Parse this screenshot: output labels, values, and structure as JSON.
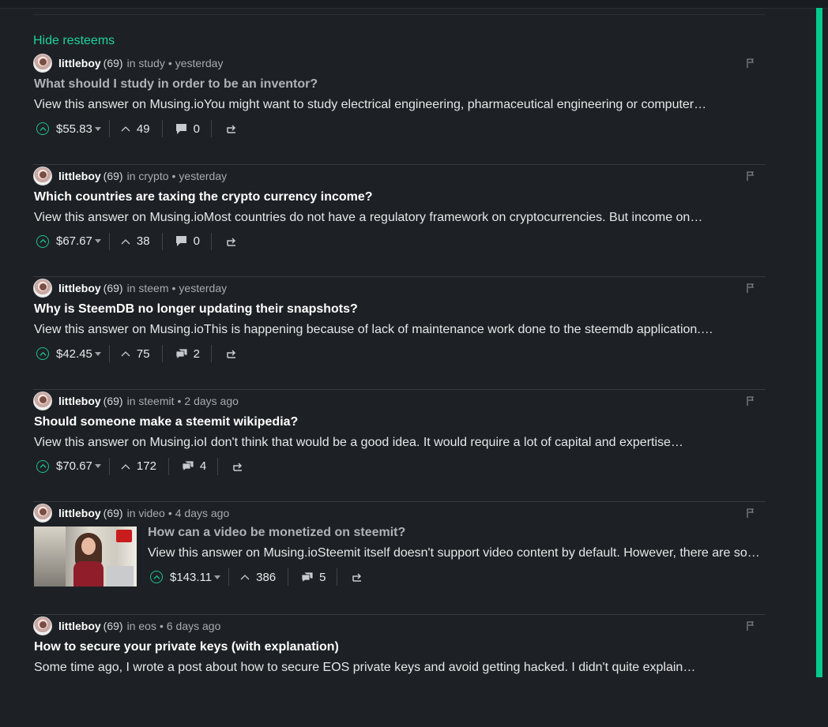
{
  "page": {
    "hide_resteems": "Hide resteems"
  },
  "posts": [
    {
      "author": "littleboy",
      "rep": "(69)",
      "in": "in",
      "category": "study",
      "time": "yesterday",
      "title": "What should I study in order to be an inventor?",
      "body": "View this answer on Musing.ioYou might want to study electrical engineering, pharmaceutical engineering or computer…",
      "payout": "$55.83",
      "votes": "49",
      "comments": "0"
    },
    {
      "author": "littleboy",
      "rep": "(69)",
      "in": "in",
      "category": "crypto",
      "time": "yesterday",
      "title": "Which countries are taxing the crypto currency income?",
      "body": "View this answer on Musing.ioMost countries do not have a regulatory framework on cryptocurrencies. But income on…",
      "payout": "$67.67",
      "votes": "38",
      "comments": "0"
    },
    {
      "author": "littleboy",
      "rep": "(69)",
      "in": "in",
      "category": "steem",
      "time": "yesterday",
      "title": "Why is SteemDB no longer updating their snapshots?",
      "body": "View this answer on Musing.ioThis is happening because of lack of maintenance work done to the steemdb application.…",
      "payout": "$42.45",
      "votes": "75",
      "comments": "2"
    },
    {
      "author": "littleboy",
      "rep": "(69)",
      "in": "in",
      "category": "steemit",
      "time": "2 days ago",
      "title": "Should someone make a steemit wikipedia?",
      "body": "View this answer on Musing.ioI don't think that would be a good idea. It would require a lot of capital and expertise…",
      "payout": "$70.67",
      "votes": "172",
      "comments": "4"
    },
    {
      "author": "littleboy",
      "rep": "(69)",
      "in": "in",
      "category": "video",
      "time": "4 days ago",
      "title": "How can a video be monetized on steemit?",
      "body": "View this answer on Musing.ioSteemit itself doesn't support video content by default. However, there are so…",
      "payout": "$143.11",
      "votes": "386",
      "comments": "5"
    },
    {
      "author": "littleboy",
      "rep": "(69)",
      "in": "in",
      "category": "eos",
      "time": "6 days ago",
      "title": "How to secure your private keys (with explanation)",
      "body": "Some time ago, I wrote a post about how to secure EOS private keys and avoid getting hacked. I didn't quite explain…"
    }
  ],
  "colors": {
    "background": "#1d2125",
    "accent": "#05c98f",
    "link": "#1fd19f"
  }
}
